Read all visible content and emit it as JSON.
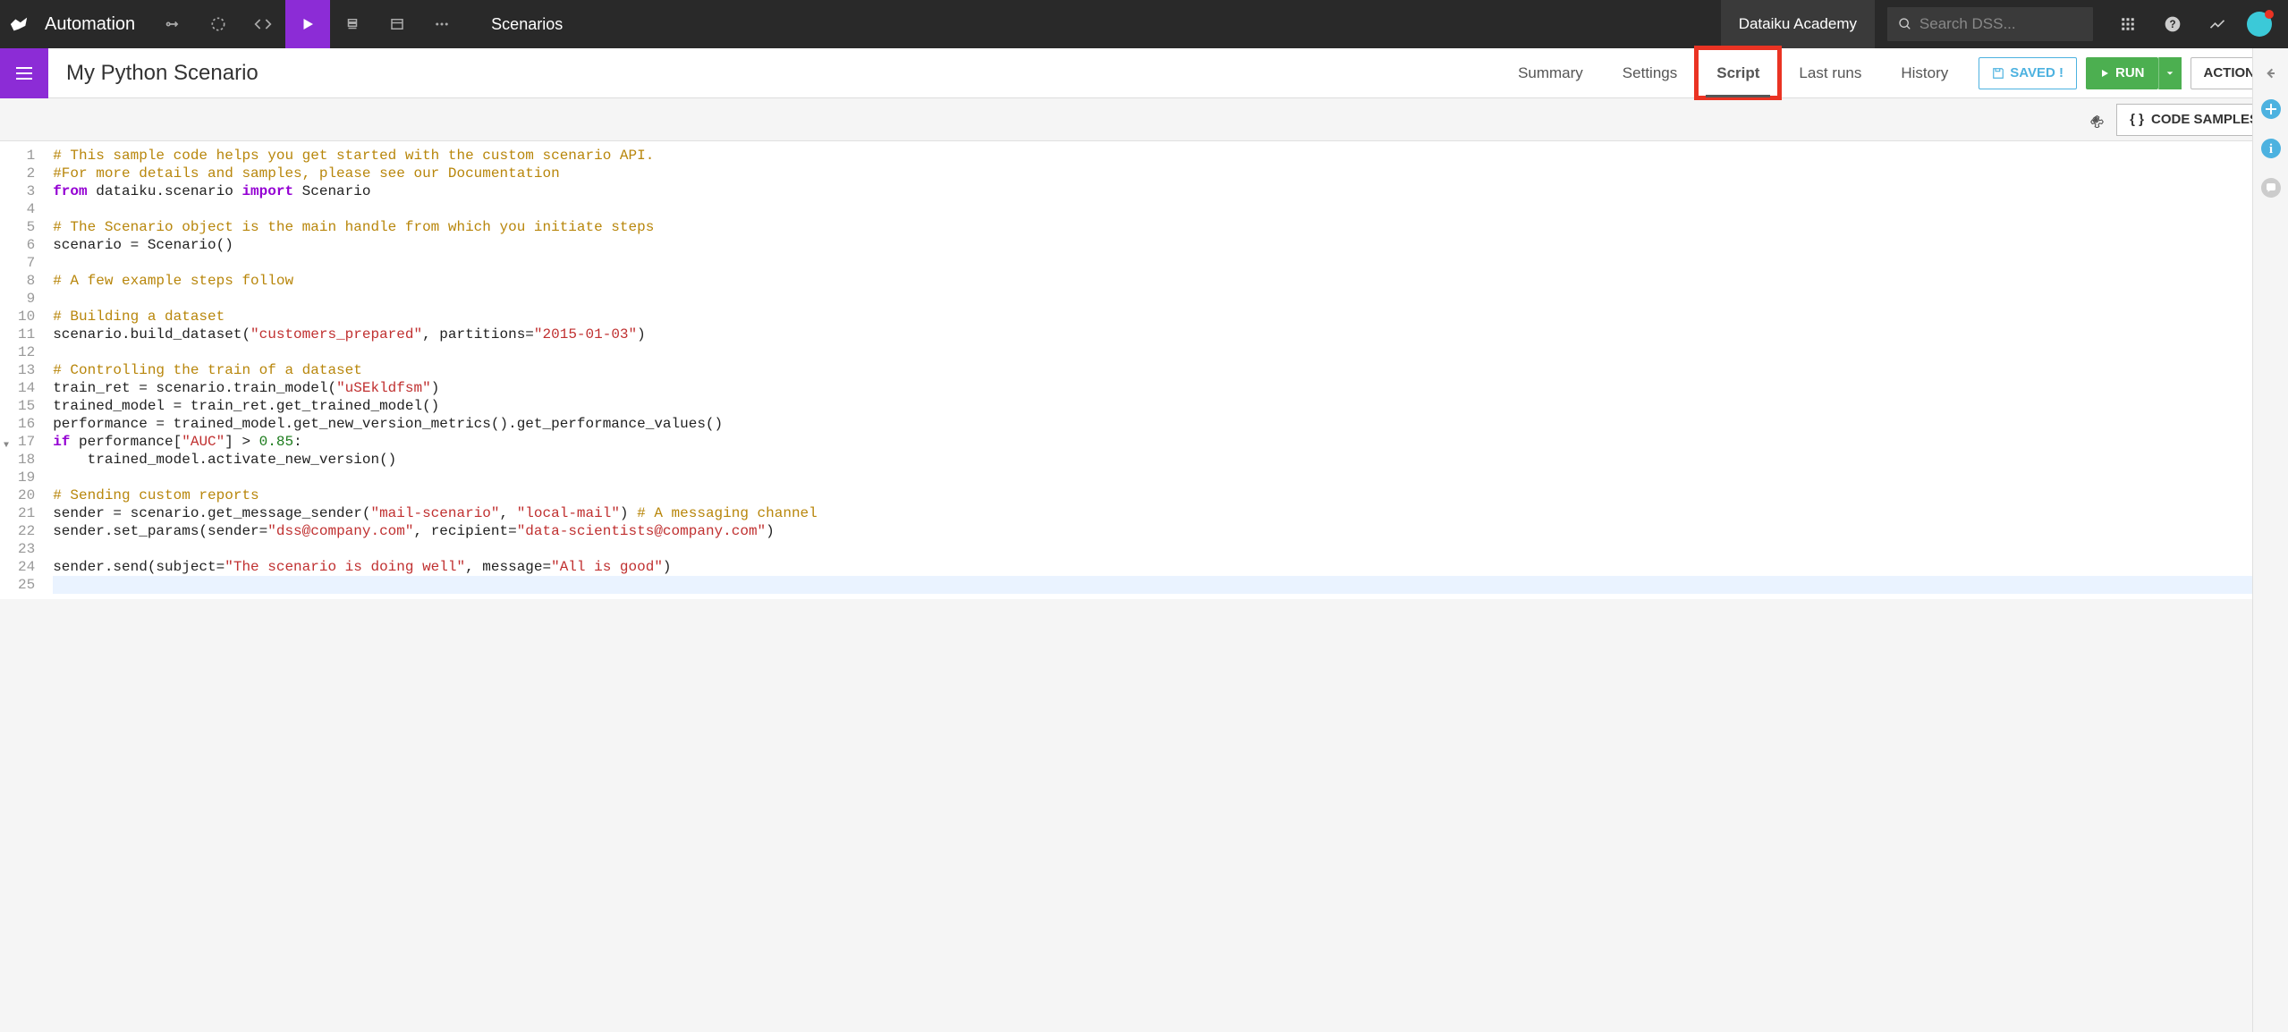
{
  "topbar": {
    "section": "Automation",
    "center_label": "Scenarios",
    "academy_label": "Dataiku Academy",
    "search_placeholder": "Search DSS..."
  },
  "subbar": {
    "title": "My Python Scenario",
    "tabs": [
      {
        "label": "Summary",
        "active": false
      },
      {
        "label": "Settings",
        "active": false
      },
      {
        "label": "Script",
        "active": true,
        "highlighted": true
      },
      {
        "label": "Last runs",
        "active": false
      },
      {
        "label": "History",
        "active": false
      }
    ],
    "saved_label": "SAVED !",
    "run_label": "RUN",
    "actions_label": "ACTIONS"
  },
  "toolbar": {
    "code_samples_label": "CODE SAMPLES"
  },
  "editor": {
    "fold_at": 17,
    "lines": [
      [
        {
          "t": "# This sample code helps you get started with the custom scenario API.",
          "c": "c-comment"
        }
      ],
      [
        {
          "t": "#For more details and samples, please see our Documentation",
          "c": "c-comment"
        }
      ],
      [
        {
          "t": "from",
          "c": "c-keyword"
        },
        {
          "t": " dataiku.scenario "
        },
        {
          "t": "import",
          "c": "c-keyword"
        },
        {
          "t": " Scenario"
        }
      ],
      [],
      [
        {
          "t": "# The Scenario object is the main handle from which you initiate steps",
          "c": "c-comment"
        }
      ],
      [
        {
          "t": "scenario = Scenario()"
        }
      ],
      [],
      [
        {
          "t": "# A few example steps follow",
          "c": "c-comment"
        }
      ],
      [],
      [
        {
          "t": "# Building a dataset",
          "c": "c-comment"
        }
      ],
      [
        {
          "t": "scenario.build_dataset("
        },
        {
          "t": "\"customers_prepared\"",
          "c": "c-string"
        },
        {
          "t": ", partitions="
        },
        {
          "t": "\"2015-01-03\"",
          "c": "c-string"
        },
        {
          "t": ")"
        }
      ],
      [],
      [
        {
          "t": "# Controlling the train of a dataset",
          "c": "c-comment"
        }
      ],
      [
        {
          "t": "train_ret = scenario.train_model("
        },
        {
          "t": "\"uSEkldfsm\"",
          "c": "c-string"
        },
        {
          "t": ")"
        }
      ],
      [
        {
          "t": "trained_model = train_ret.get_trained_model()"
        }
      ],
      [
        {
          "t": "performance = trained_model.get_new_version_metrics().get_performance_values()"
        }
      ],
      [
        {
          "t": "if",
          "c": "c-keyword"
        },
        {
          "t": " performance["
        },
        {
          "t": "\"AUC\"",
          "c": "c-string"
        },
        {
          "t": "] > "
        },
        {
          "t": "0.85",
          "c": "c-num"
        },
        {
          "t": ":"
        }
      ],
      [
        {
          "t": "    trained_model.activate_new_version()"
        }
      ],
      [],
      [
        {
          "t": "# Sending custom reports",
          "c": "c-comment"
        }
      ],
      [
        {
          "t": "sender = scenario.get_message_sender("
        },
        {
          "t": "\"mail-scenario\"",
          "c": "c-string"
        },
        {
          "t": ", "
        },
        {
          "t": "\"local-mail\"",
          "c": "c-string"
        },
        {
          "t": ") "
        },
        {
          "t": "# A messaging channel",
          "c": "c-comment"
        }
      ],
      [
        {
          "t": "sender.set_params(sender="
        },
        {
          "t": "\"dss@company.com\"",
          "c": "c-string"
        },
        {
          "t": ", recipient="
        },
        {
          "t": "\"data-scientists@company.com\"",
          "c": "c-string"
        },
        {
          "t": ")"
        }
      ],
      [],
      [
        {
          "t": "sender.send(subject="
        },
        {
          "t": "\"The scenario is doing well\"",
          "c": "c-string"
        },
        {
          "t": ", message="
        },
        {
          "t": "\"All is good\"",
          "c": "c-string"
        },
        {
          "t": ")"
        }
      ],
      []
    ],
    "current_line": 25
  }
}
